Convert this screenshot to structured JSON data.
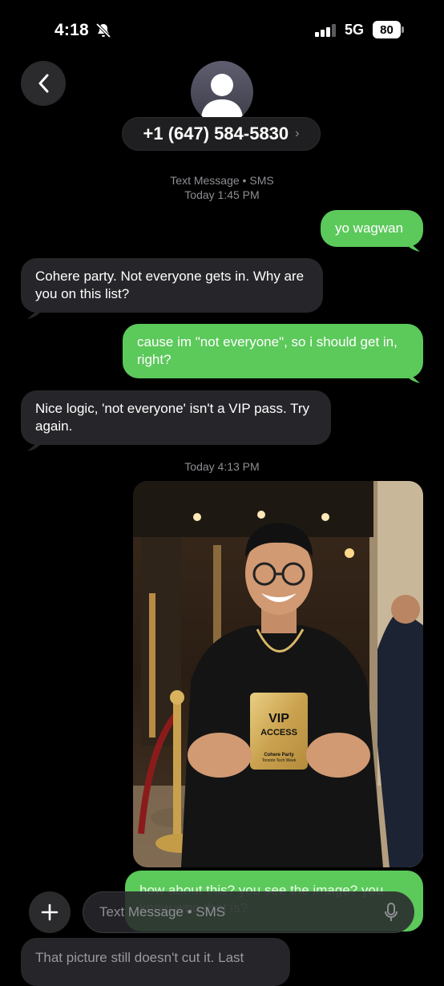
{
  "status_bar": {
    "time": "4:18",
    "network": "5G",
    "battery": "80"
  },
  "header": {
    "contact_number": "+1 (647) 584-5830",
    "chevron": "›"
  },
  "thread": {
    "service_label": "Text Message • SMS",
    "first_timestamp": "Today 1:45 PM",
    "second_timestamp": "Today 4:13 PM"
  },
  "messages": [
    {
      "from": "me",
      "text": "yo wagwan"
    },
    {
      "from": "them",
      "text": "Cohere party. Not everyone gets in. Why are you on this list?"
    },
    {
      "from": "me",
      "text": "cause im \"not everyone\", so i should get in, right?"
    },
    {
      "from": "them",
      "text": "Nice logic, 'not everyone' isn't a VIP pass. Try again."
    },
    {
      "from": "me",
      "text": "how about this? you see the image? you know who that is?"
    },
    {
      "from": "them",
      "text": "That picture still doesn't cut it. Last"
    }
  ],
  "photo": {
    "badge_line1": "VIP",
    "badge_line2": "ACCESS",
    "badge_line3": "Cohere Party",
    "badge_line4": "Toronto Tech Week"
  },
  "input": {
    "placeholder": "Text Message • SMS"
  },
  "colors": {
    "sms_green": "#5cc95b",
    "incoming_gray": "#26262a",
    "background": "#000000"
  }
}
